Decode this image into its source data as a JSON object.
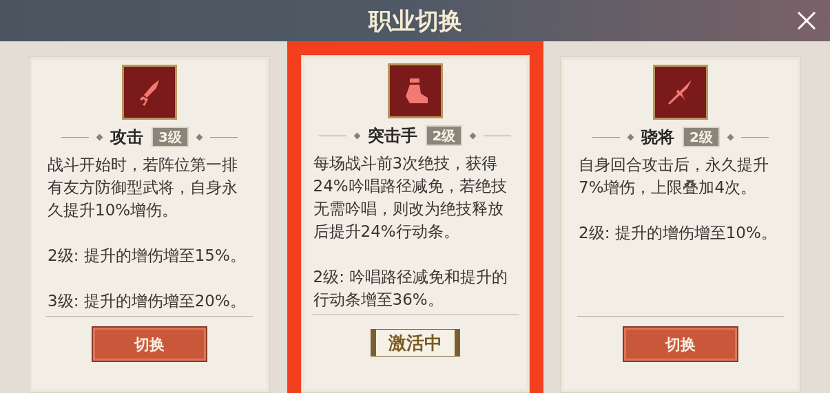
{
  "title": "职业切换",
  "cards": [
    {
      "name": "攻击",
      "level": "3级",
      "selected": false,
      "paragraphs": [
        "战斗开始时，若阵位第一排有友方防御型武将，自身永久提升10%增伤。",
        "2级: 提升的增伤增至15%。",
        "3级: 提升的增伤增至20%。"
      ],
      "action": {
        "kind": "button",
        "label": "切换"
      }
    },
    {
      "name": "突击手",
      "level": "2级",
      "selected": true,
      "paragraphs": [
        "每场战斗前3次绝技，获得24%吟唱路径减免，若绝技无需吟唱，则改为绝技释放后提升24%行动条。",
        "2级: 吟唱路径减免和提升的行动条增至36%。"
      ],
      "action": {
        "kind": "status",
        "label": "激活中"
      }
    },
    {
      "name": "骁将",
      "level": "2级",
      "selected": false,
      "paragraphs": [
        "自身回合攻击后，永久提升7%增伤，上限叠加4次。",
        "2级: 提升的增伤增至10%。"
      ],
      "action": {
        "kind": "button",
        "label": "切换"
      }
    }
  ]
}
